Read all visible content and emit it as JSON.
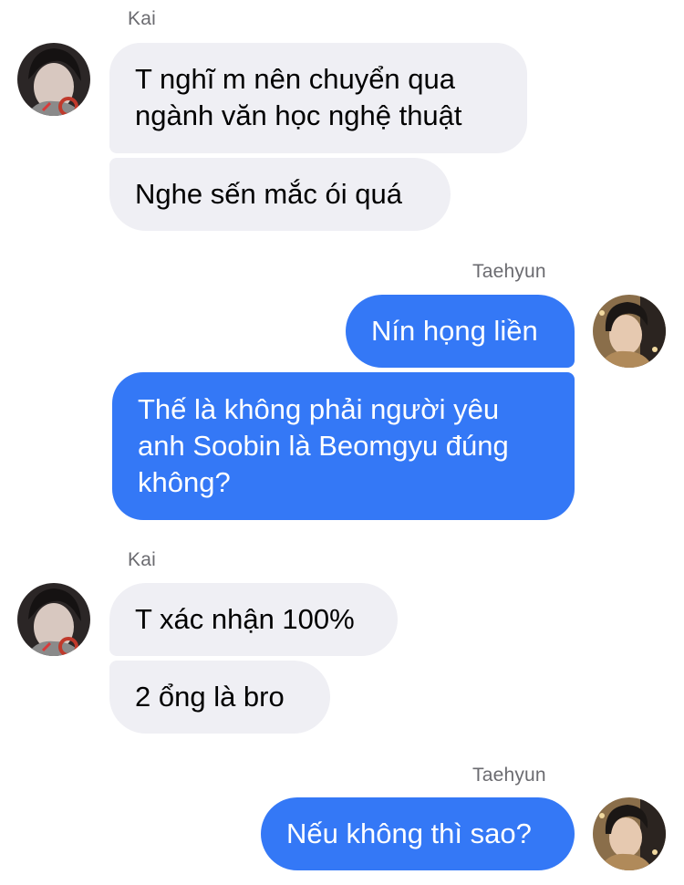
{
  "messages": [
    {
      "sender": "Kai",
      "direction": "incoming",
      "avatar": "kai-avatar",
      "bubbles": [
        {
          "lines": [
            "T nghĩ m nên chuyển qua",
            "ngành văn học nghệ thuật"
          ]
        },
        {
          "lines": [
            "Nghe sến mắc ói quá"
          ]
        }
      ]
    },
    {
      "sender": "Taehyun",
      "direction": "outgoing",
      "avatar": "taehyun-avatar",
      "bubbles": [
        {
          "lines": [
            "Nín họng liền"
          ]
        },
        {
          "lines": [
            "Thế là không phải người yêu",
            "anh Soobin là Beomgyu đúng",
            "không?"
          ]
        }
      ]
    },
    {
      "sender": "Kai",
      "direction": "incoming",
      "avatar": "kai-avatar",
      "bubbles": [
        {
          "lines": [
            "T xác nhận 100%"
          ]
        },
        {
          "lines": [
            "2 ổng là bro"
          ]
        }
      ]
    },
    {
      "sender": "Taehyun",
      "direction": "outgoing",
      "avatar": "taehyun-avatar",
      "bubbles": [
        {
          "lines": [
            "Nếu không thì sao?"
          ]
        }
      ]
    }
  ],
  "colors": {
    "incoming_bubble": "#efeff4",
    "outgoing_bubble": "#3478f6",
    "sender_name": "#6b6b70"
  }
}
